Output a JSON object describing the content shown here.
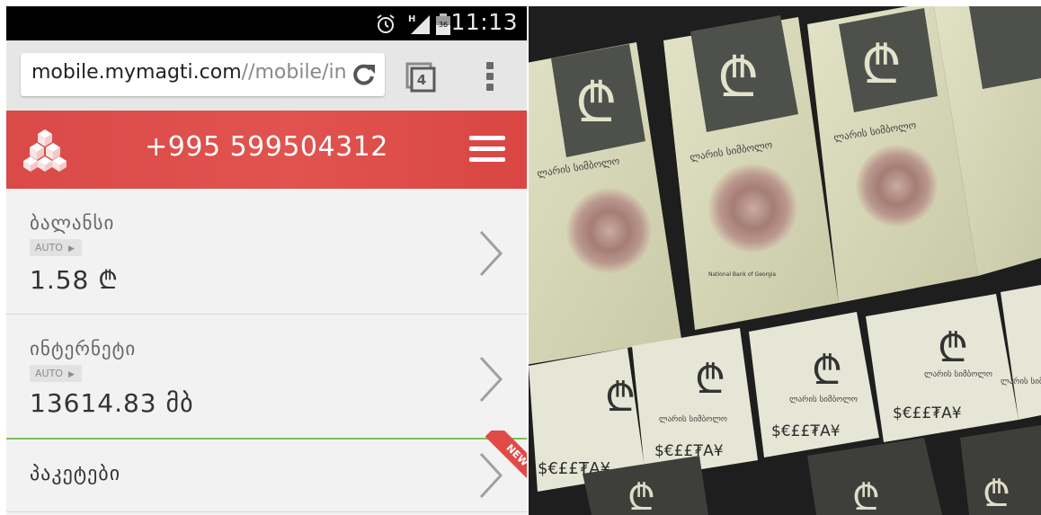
{
  "status_bar": {
    "network": "H",
    "battery_level": "36",
    "time": "11:13",
    "icons": [
      "alarm-icon",
      "signal-icon",
      "battery-icon"
    ]
  },
  "browser": {
    "url_main": "mobile.mymagti.com",
    "url_rest": "//mobile/in",
    "tab_count": "4",
    "icons": [
      "reload-icon",
      "tabs-icon",
      "menu-dots-icon"
    ]
  },
  "header": {
    "phone_number": "+995 599504312",
    "icons": [
      "logo-icon",
      "hamburger-icon"
    ],
    "colors": {
      "header_red": "#df4e4b",
      "divider_green": "#7cc354"
    }
  },
  "rows": [
    {
      "title": "ბალანსი",
      "badge": "AUTO",
      "value": "1.58 ₾"
    },
    {
      "title": "ინტერნეტი",
      "badge": "AUTO",
      "value": "13614.83 მბ"
    },
    {
      "title": "პაკეტები",
      "ribbon": "NEW"
    }
  ],
  "photo": {
    "large_banknote_texts": [
      "ლარის სიმბოლო",
      "ლარის სიმბოლო",
      "ლარის სიმბოლო"
    ],
    "small_banknote_texts": [
      "ლარის სიმბოლო",
      "ლარის სიმბოლო",
      "ლარის სიმბოლო",
      "ლარის სიმბოლო"
    ],
    "currency_strip": "$€££₮A¥",
    "bank_name": "National Bank of Georgia",
    "lari_sign": "₾"
  }
}
